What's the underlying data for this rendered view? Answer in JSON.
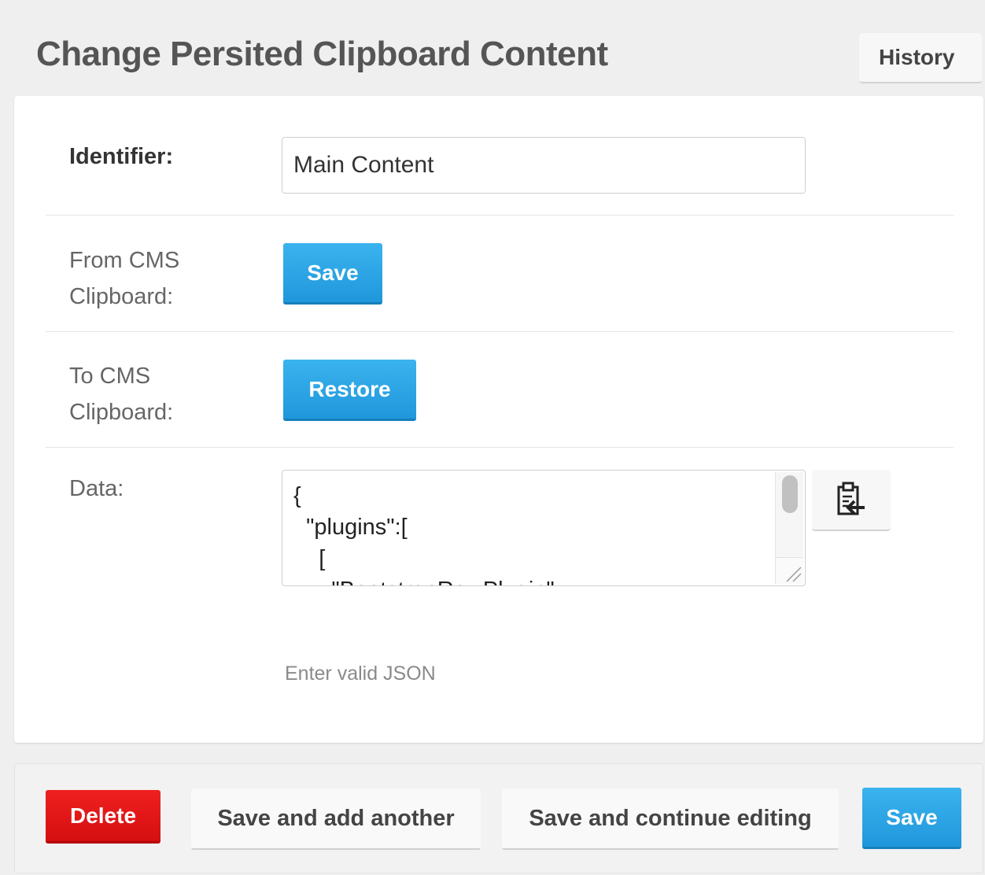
{
  "header": {
    "title": "Change Persited Clipboard Content",
    "history_label": "History"
  },
  "form": {
    "identifier": {
      "label": "Identifier:",
      "value": "Main Content"
    },
    "from_cms": {
      "label_line1": "From CMS",
      "label_line2": "Clipboard:",
      "button_label": "Save"
    },
    "to_cms": {
      "label_line1": "To CMS",
      "label_line2": "Clipboard:",
      "button_label": "Restore"
    },
    "data": {
      "label": "Data:",
      "value": "{\n  \"plugins\":[\n    [\n      \"BootstrapRowPlugin\",",
      "help_text": "Enter valid JSON",
      "paste_icon": "clipboard-paste-icon"
    }
  },
  "submit_row": {
    "delete_label": "Delete",
    "save_add_label": "Save and add another",
    "save_continue_label": "Save and continue editing",
    "save_label": "Save"
  },
  "colors": {
    "primary": "#1f97db",
    "danger": "#d40f0f",
    "background": "#efefef"
  }
}
